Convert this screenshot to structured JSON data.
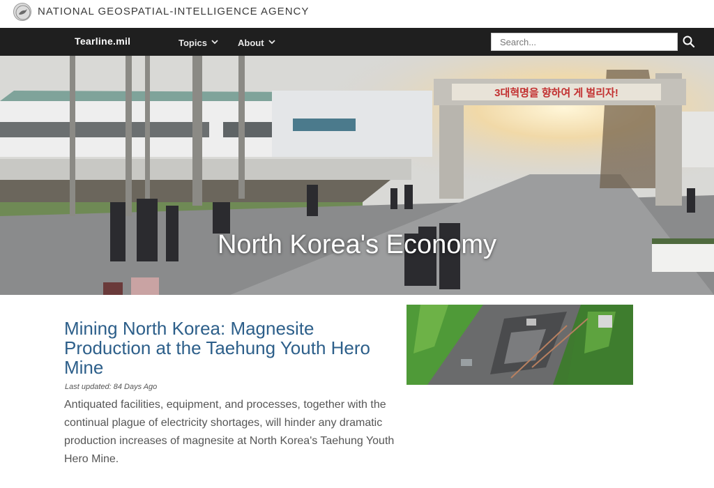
{
  "agency": {
    "name": "NATIONAL GEOSPATIAL-INTELLIGENCE AGENCY",
    "seal_icon": "agency-seal-icon"
  },
  "nav": {
    "brand": "Tearline.mil",
    "items": [
      {
        "label": "Topics",
        "icon": "chevron-down-icon"
      },
      {
        "label": "About",
        "icon": "chevron-down-icon"
      }
    ],
    "search": {
      "placeholder": "Search...",
      "icon": "search-icon"
    }
  },
  "hero": {
    "title": "North Korea's Economy",
    "banner_text": "3대혁명을 향하여 게 벌리자!"
  },
  "article": {
    "title": "Mining North Korea: Magnesite Production at the Taehung Youth Hero Mine",
    "updated": "Last updated: 84 Days Ago",
    "summary": "Antiquated facilities, equipment, and processes, together with the continual plague of electricity shortages, will hinder any dramatic production increases of magnesite at North Korea's Taehung Youth Hero Mine."
  },
  "colors": {
    "nav_bg": "#1f1f1f",
    "link": "#2d5f8a",
    "body_text": "#555555"
  }
}
